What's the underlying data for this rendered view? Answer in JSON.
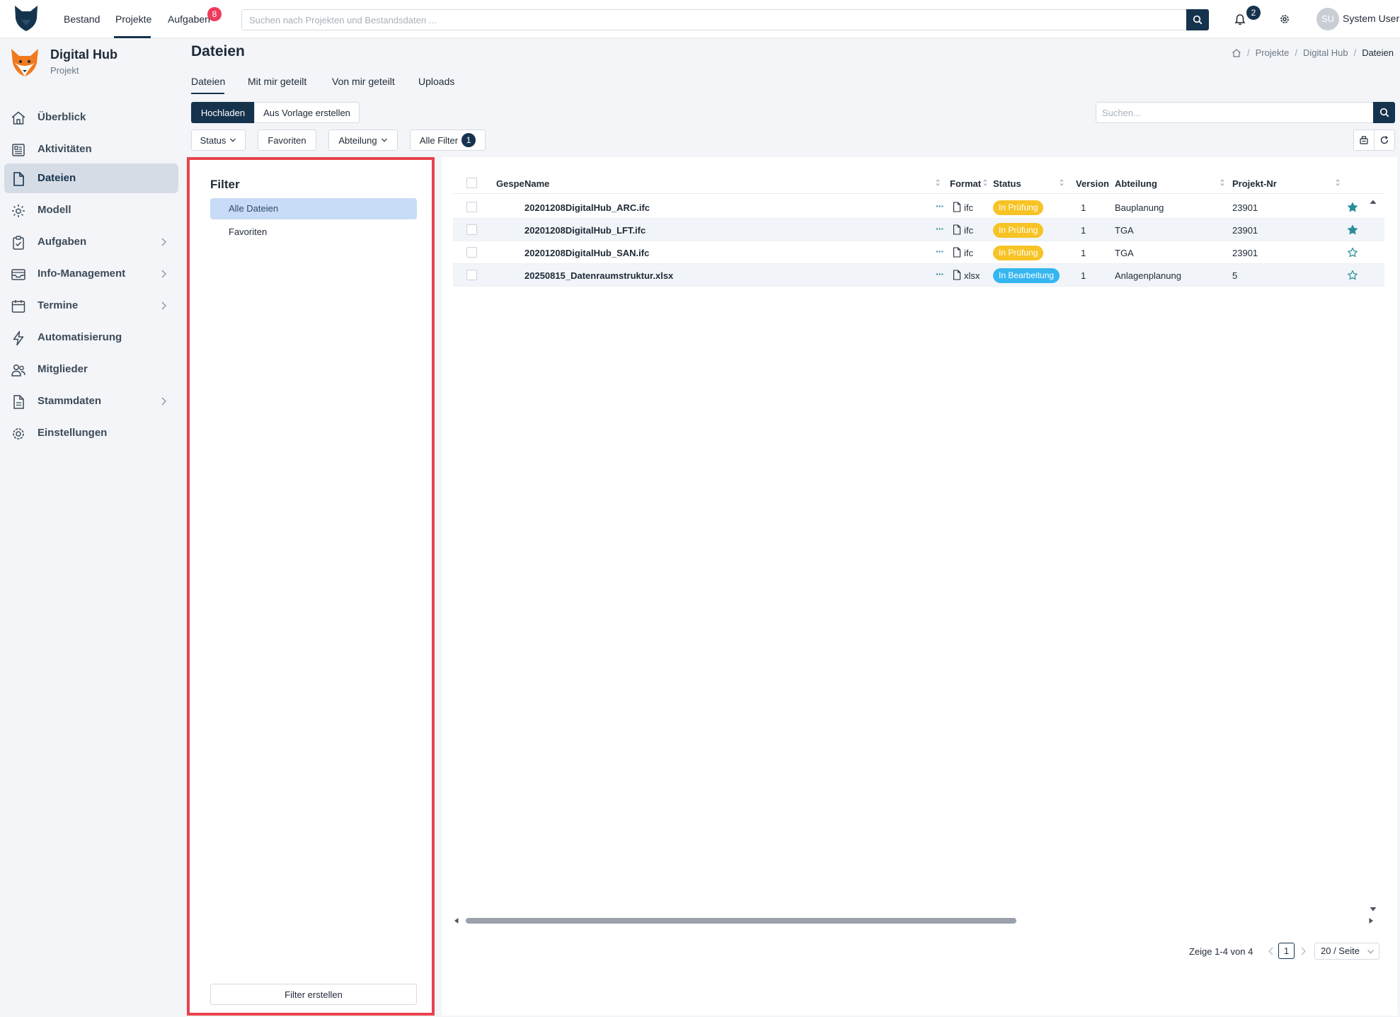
{
  "topbar": {
    "nav": [
      {
        "label": "Bestand"
      },
      {
        "label": "Projekte"
      },
      {
        "label": "Aufgaben"
      }
    ],
    "aufgaben_badge": "8",
    "search_placeholder": "Suchen nach Projekten und Bestandsdaten ...",
    "notifications_badge": "2",
    "user_initials": "SU",
    "user_name": "System User"
  },
  "project": {
    "name": "Digital Hub",
    "subtitle": "Projekt"
  },
  "sidebar": {
    "items": [
      {
        "label": "Überblick",
        "icon": "home-icon",
        "expandable": false,
        "active": false
      },
      {
        "label": "Aktivitäten",
        "icon": "activity-icon",
        "expandable": false,
        "active": false
      },
      {
        "label": "Dateien",
        "icon": "file-icon",
        "expandable": false,
        "active": true
      },
      {
        "label": "Modell",
        "icon": "model-icon",
        "expandable": false,
        "active": false
      },
      {
        "label": "Aufgaben",
        "icon": "clipboard-icon",
        "expandable": true,
        "active": false
      },
      {
        "label": "Info-Management",
        "icon": "inbox-icon",
        "expandable": true,
        "active": false
      },
      {
        "label": "Termine",
        "icon": "calendar-icon",
        "expandable": true,
        "active": false
      },
      {
        "label": "Automatisierung",
        "icon": "bolt-icon",
        "expandable": false,
        "active": false
      },
      {
        "label": "Mitglieder",
        "icon": "users-icon",
        "expandable": false,
        "active": false
      },
      {
        "label": "Stammdaten",
        "icon": "document-icon",
        "expandable": true,
        "active": false
      },
      {
        "label": "Einstellungen",
        "icon": "gear-icon",
        "expandable": false,
        "active": false
      }
    ]
  },
  "header": {
    "title": "Dateien",
    "breadcrumb": [
      "Projekte",
      "Digital Hub",
      "Dateien"
    ]
  },
  "tabs": [
    {
      "label": "Dateien",
      "active": true
    },
    {
      "label": "Mit mir geteilt",
      "active": false
    },
    {
      "label": "Von mir geteilt",
      "active": false
    },
    {
      "label": "Uploads",
      "active": false
    }
  ],
  "actions": {
    "upload_label": "Hochladen",
    "template_label": "Aus Vorlage erstellen",
    "search_placeholder": "Suchen..."
  },
  "filters": {
    "status_label": "Status",
    "favorites_label": "Favoriten",
    "department_label": "Abteilung",
    "all_filters_label": "Alle Filter",
    "all_filters_count": "1"
  },
  "filter_panel": {
    "title": "Filter",
    "items": [
      {
        "label": "Alle Dateien",
        "active": true
      },
      {
        "label": "Favoriten",
        "active": false
      }
    ],
    "create_label": "Filter erstellen"
  },
  "table": {
    "columns": {
      "locked": "Gesperrt",
      "name": "Name",
      "format": "Format",
      "status": "Status",
      "version": "Version",
      "department": "Abteilung",
      "project_no": "Projekt-Nr"
    },
    "rows": [
      {
        "name": "20201208DigitalHub_ARC.ifc",
        "format": "ifc",
        "status": "In Prüfung",
        "version": "1",
        "department": "Bauplanung",
        "project_no": "23901",
        "favorite": true
      },
      {
        "name": "20201208DigitalHub_LFT.ifc",
        "format": "ifc",
        "status": "In Prüfung",
        "version": "1",
        "department": "TGA",
        "project_no": "23901",
        "favorite": true
      },
      {
        "name": "20201208DigitalHub_SAN.ifc",
        "format": "ifc",
        "status": "In Prüfung",
        "version": "1",
        "department": "TGA",
        "project_no": "23901",
        "favorite": false
      },
      {
        "name": "20250815_Datenraumstruktur.xlsx",
        "format": "xlsx",
        "status": "In Bearbeitung",
        "version": "1",
        "department": "Anlagenplanung",
        "project_no": "5",
        "favorite": false
      }
    ],
    "status_colors": {
      "In Prüfung": "#f7c325",
      "In Bearbeitung": "#35b6f0"
    },
    "accent_color": "#2b8d99"
  },
  "pagination": {
    "info": "Zeige 1-4 von 4",
    "current_page": "1",
    "page_size": "20 / Seite"
  }
}
